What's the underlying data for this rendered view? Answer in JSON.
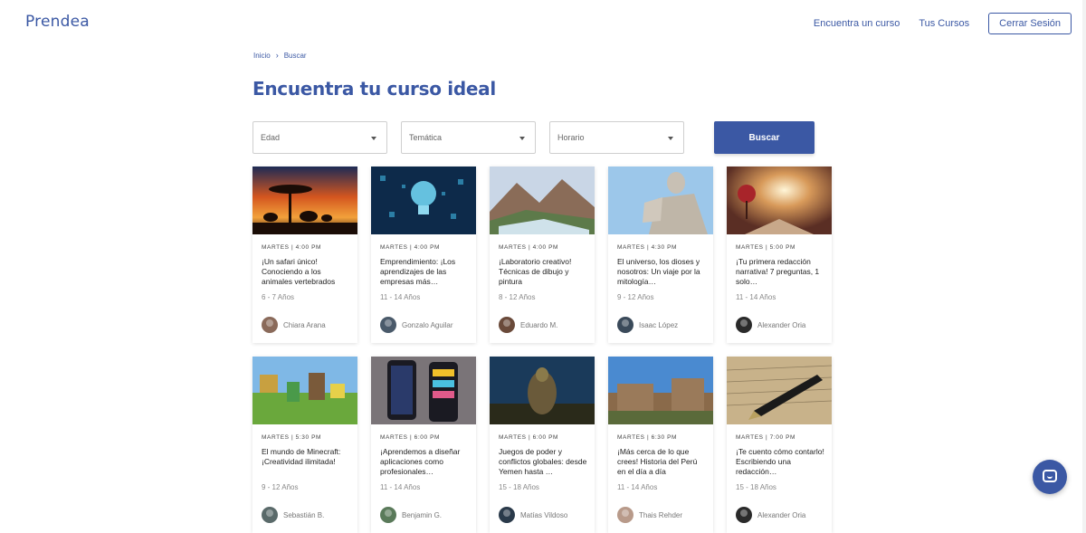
{
  "header": {
    "logo_text": "Prendea",
    "nav": {
      "find_course": "Encuentra un curso",
      "your_courses": "Tus Cursos",
      "logout": "Cerrar Sesión"
    }
  },
  "breadcrumb": {
    "home": "Inicio",
    "current": "Buscar",
    "separator": "›"
  },
  "page_title": "Encuentra tu curso ideal",
  "filters": {
    "age": "Edad",
    "topic": "Temática",
    "schedule": "Horario",
    "search_button": "Buscar"
  },
  "courses": [
    {
      "meta": "MARTES | 4:00 PM",
      "title": "¡Un safari único! Conociendo a los animales vertebrados",
      "ages": "6 - 7 Años",
      "teacher": "Chiara Arana"
    },
    {
      "meta": "MARTES | 4:00 PM",
      "title": "Emprendimiento: ¡Los aprendizajes de las empresas más…",
      "ages": "11 - 14 Años",
      "teacher": "Gonzalo Aguilar"
    },
    {
      "meta": "MARTES | 4:00 PM",
      "title": "¡Laboratorio creativo! Técnicas de dibujo y pintura",
      "ages": "8 - 12 Años",
      "teacher": "Eduardo M."
    },
    {
      "meta": "MARTES | 4:30 PM",
      "title": "El universo, los dioses y nosotros: Un viaje por la mitología…",
      "ages": "9 - 12 Años",
      "teacher": "Isaac López"
    },
    {
      "meta": "MARTES | 5:00 PM",
      "title": "¡Tu primera redacción narrativa! 7 preguntas, 1 solo…",
      "ages": "11 - 14 Años",
      "teacher": "Alexander Oria"
    },
    {
      "meta": "MARTES | 5:30 PM",
      "title": "El mundo de Minecraft: ¡Creatividad ilimitada!",
      "ages": "9 - 12 Años",
      "teacher": "Sebastián B."
    },
    {
      "meta": "MARTES | 6:00 PM",
      "title": "¡Aprendemos a diseñar aplicaciones como profesionales…",
      "ages": "11 - 14 Años",
      "teacher": "Benjamin G."
    },
    {
      "meta": "MARTES | 6:00 PM",
      "title": "Juegos de poder y conflictos globales: desde Yemen hasta …",
      "ages": "15 - 18 Años",
      "teacher": "Matías Vildoso"
    },
    {
      "meta": "MARTES | 6:30 PM",
      "title": "¡Más cerca de lo que crees! Historia del Perú en el día a día",
      "ages": "11 - 14 Años",
      "teacher": "Thais Rehder"
    },
    {
      "meta": "MARTES | 7:00 PM",
      "title": "¡Te cuento cómo contarlo! Escribiendo una redacción…",
      "ages": "15 - 18 Años",
      "teacher": "Alexander Oria"
    }
  ],
  "colors": {
    "brand": "#3b58a4"
  },
  "icons": {
    "chat": "chat-icon",
    "caret": "caret-down-icon",
    "breadcrumb_sep": "chevron-right-icon"
  }
}
